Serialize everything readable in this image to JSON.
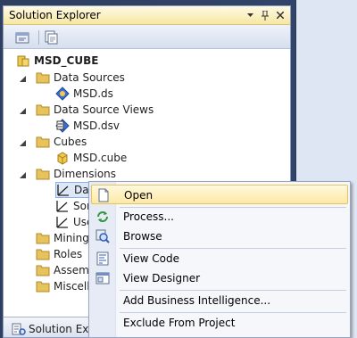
{
  "panel": {
    "title": "Solution Explorer",
    "footer_tab": "Solution Explorer"
  },
  "tree": {
    "project": "MSD_CUBE",
    "data_sources": {
      "label": "Data Sources",
      "items": [
        "MSD.ds"
      ]
    },
    "dsv": {
      "label": "Data Source Views",
      "items": [
        "MSD.dsv"
      ]
    },
    "cubes": {
      "label": "Cubes",
      "items": [
        "MSD.cube"
      ]
    },
    "dimensions": {
      "label": "Dimensions",
      "items": [
        "Date",
        "Son",
        "Use"
      ]
    },
    "mining": "Mining",
    "roles": "Roles",
    "assemblies": "Assemb",
    "misc": "Miscella"
  },
  "context_menu": {
    "items": [
      {
        "label": "Open",
        "icon": "open-icon"
      },
      {
        "label": "Process...",
        "icon": "process-icon"
      },
      {
        "label": "Browse",
        "icon": "browse-icon"
      },
      {
        "label": "View Code",
        "icon": "view-code-icon"
      },
      {
        "label": "View Designer",
        "icon": "view-designer-icon"
      },
      {
        "label": "Add Business Intelligence...",
        "icon": ""
      },
      {
        "label": "Exclude From Project",
        "icon": ""
      }
    ]
  },
  "colors": {
    "highlight": "#fde9a6",
    "titlebar": "#f6e7a3",
    "folder": "#e8c25a"
  }
}
